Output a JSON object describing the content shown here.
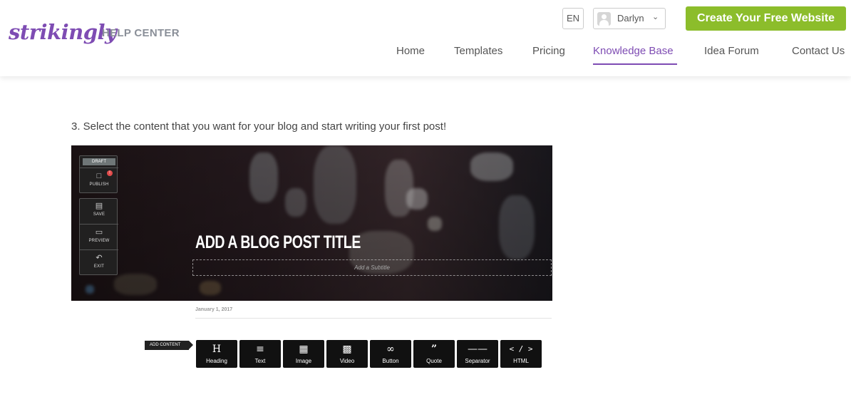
{
  "brand": {
    "logo": "strikingly",
    "section": "HELP CENTER"
  },
  "header": {
    "language": "EN",
    "user_name": "Darlyn",
    "cta_label": "Create Your Free Website"
  },
  "nav": {
    "items": [
      {
        "label": "Home"
      },
      {
        "label": "Templates"
      },
      {
        "label": "Pricing"
      },
      {
        "label": "Knowledge Base",
        "active": true
      },
      {
        "label": "Idea Forum"
      },
      {
        "label": "Contact Us"
      }
    ],
    "active_color": "#7e4cb3"
  },
  "article": {
    "step_text": "3. Select the content that you want for your blog and start writing your first post!"
  },
  "screenshot": {
    "side_panel": {
      "draft_label": "DRAFT",
      "alert_badge": "!",
      "publish": "PUBLISH",
      "save": "SAVE",
      "preview": "PREVIEW",
      "exit": "EXIT"
    },
    "post_title": "ADD A BLOG POST TITLE",
    "subtitle_placeholder": "Add a Subtitle",
    "date": "January 1, 2017",
    "add_content_label": "ADD CONTENT",
    "tools": [
      {
        "label": "Heading",
        "icon": "heading-icon"
      },
      {
        "label": "Text",
        "icon": "text-lines-icon"
      },
      {
        "label": "Image",
        "icon": "image-icon"
      },
      {
        "label": "Video",
        "icon": "film-icon"
      },
      {
        "label": "Button",
        "icon": "link-icon"
      },
      {
        "label": "Quote",
        "icon": "quote-icon"
      },
      {
        "label": "Separator",
        "icon": "separator-icon"
      },
      {
        "label": "HTML",
        "icon": "code-icon"
      }
    ]
  },
  "colors": {
    "brand_purple": "#7e4cb3",
    "cta_green": "#8cbd2b"
  }
}
